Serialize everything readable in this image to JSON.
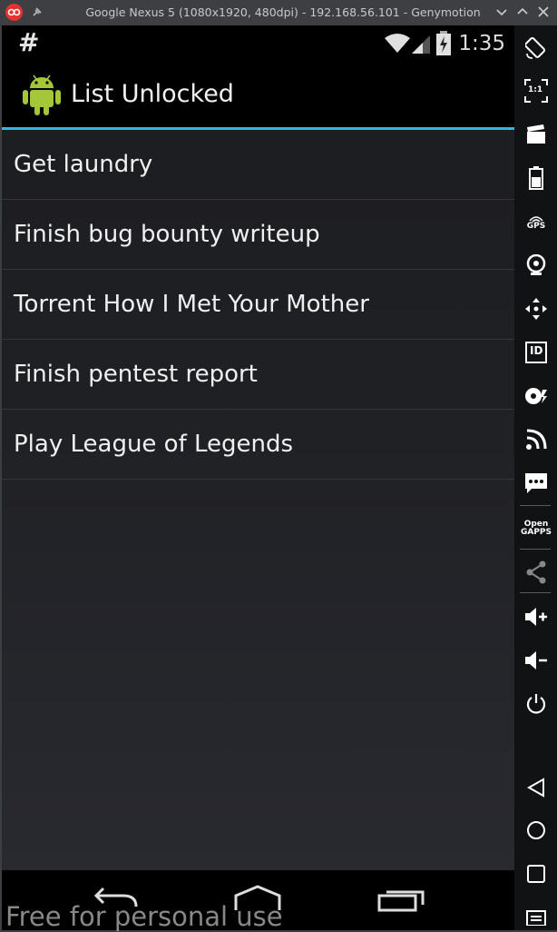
{
  "window": {
    "title": "Google Nexus 5 (1080x1920, 480dpi) - 192.168.56.101 - Genymotion"
  },
  "status_bar": {
    "left_glyph": "#",
    "time": "1:35",
    "icons": [
      "wifi-icon",
      "signal-icon",
      "battery-icon"
    ]
  },
  "action_bar": {
    "title": "List Unlocked",
    "logo_icon": "android-icon"
  },
  "list": {
    "items": [
      "Get laundry",
      "Finish bug bounty writeup",
      "Torrent How I Met Your Mother",
      "Finish pentest report",
      "Play League of Legends"
    ]
  },
  "nav_bar": {
    "buttons": [
      "back-icon",
      "home-icon",
      "recents-icon"
    ]
  },
  "side_toolbar": {
    "tools": [
      {
        "name": "rotate-icon"
      },
      {
        "name": "pixel-perfect-icon",
        "text": "1:1"
      },
      {
        "name": "screencast-icon"
      },
      {
        "name": "battery-icon"
      },
      {
        "name": "gps-icon",
        "text": "GPS"
      },
      {
        "name": "camera-icon"
      },
      {
        "name": "remote-control-icon"
      },
      {
        "name": "device-id-icon",
        "text": "ID"
      },
      {
        "name": "disk-io-icon"
      },
      {
        "name": "network-icon"
      },
      {
        "name": "sms-icon"
      },
      {
        "name": "open-gapps-icon",
        "text": "Open\nGAPPS"
      },
      {
        "name": "share-icon"
      },
      {
        "name": "volume-up-icon"
      },
      {
        "name": "volume-down-icon"
      },
      {
        "name": "power-icon"
      },
      {
        "name": "back-icon"
      },
      {
        "name": "home-icon"
      },
      {
        "name": "recents-icon"
      },
      {
        "name": "menu-icon"
      }
    ]
  },
  "colors": {
    "accent": "#33b5e5",
    "android_green": "#a4c639",
    "app_logo": "#e8322e"
  },
  "watermark": "Free for personal use"
}
